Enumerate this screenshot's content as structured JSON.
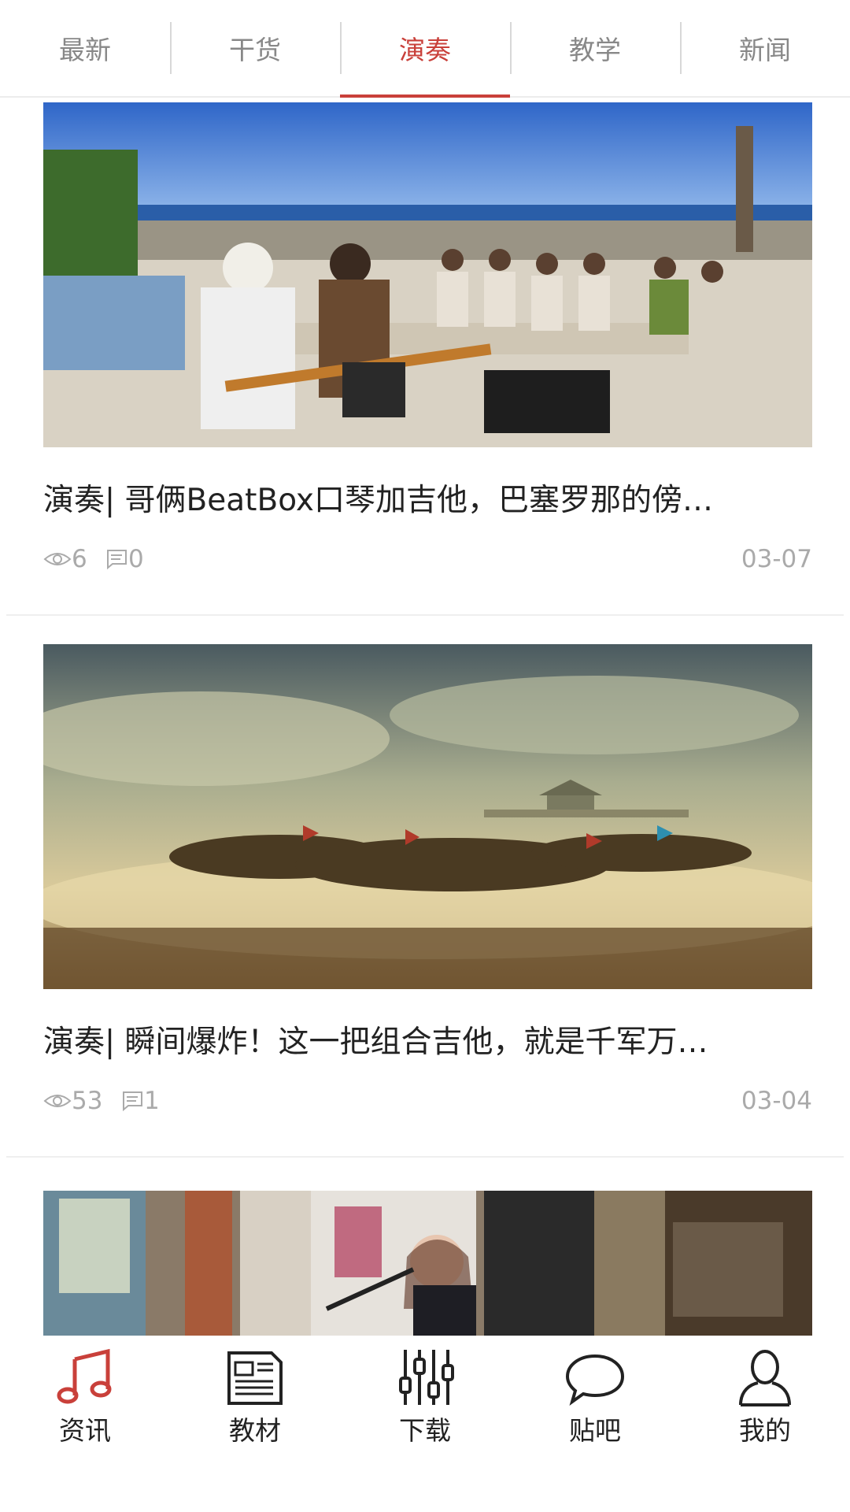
{
  "tabs": [
    {
      "label": "最新",
      "active": false
    },
    {
      "label": "干货",
      "active": false
    },
    {
      "label": "演奏",
      "active": true
    },
    {
      "label": "教学",
      "active": false
    },
    {
      "label": "新闻",
      "active": false
    }
  ],
  "articles": [
    {
      "title": "演奏| 哥俩BeatBox口琴加吉他，巴塞罗那的傍…",
      "views": "6",
      "comments": "0",
      "date": "03-07"
    },
    {
      "title": "演奏| 瞬间爆炸！这一把组合吉他，就是千军万…",
      "views": "53",
      "comments": "1",
      "date": "03-04"
    },
    {
      "title": "",
      "views": "",
      "comments": "",
      "date": ""
    }
  ],
  "bottom_nav": [
    {
      "label": "资讯",
      "icon": "music-note-icon",
      "active": true
    },
    {
      "label": "教材",
      "icon": "newspaper-icon",
      "active": false
    },
    {
      "label": "下载",
      "icon": "equalizer-icon",
      "active": false
    },
    {
      "label": "贴吧",
      "icon": "speech-bubble-icon",
      "active": false
    },
    {
      "label": "我的",
      "icon": "person-icon",
      "active": false
    }
  ],
  "colors": {
    "accent": "#c9403a",
    "text": "#222222",
    "muted": "#aaaaaa"
  }
}
